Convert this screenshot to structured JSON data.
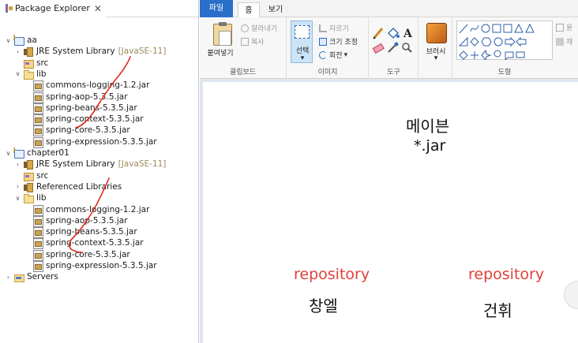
{
  "explorer": {
    "tab_label": "Package Explorer",
    "close_glyph": "✕",
    "tree": [
      {
        "label": "aa",
        "suffix": "",
        "icon": "project",
        "expanded": true
      },
      {
        "label": "JRE System Library",
        "suffix": "[JavaSE-11]",
        "icon": "library",
        "expanded": false
      },
      {
        "label": "src",
        "suffix": "",
        "icon": "src-folder",
        "expanded": null
      },
      {
        "label": "lib",
        "suffix": "",
        "icon": "folder",
        "expanded": true
      },
      {
        "label": "commons-logging-1.2.jar",
        "suffix": "",
        "icon": "jar",
        "expanded": null
      },
      {
        "label": "spring-aop-5.3.5.jar",
        "suffix": "",
        "icon": "jar",
        "expanded": null
      },
      {
        "label": "spring-beans-5.3.5.jar",
        "suffix": "",
        "icon": "jar",
        "expanded": null
      },
      {
        "label": "spring-context-5.3.5.jar",
        "suffix": "",
        "icon": "jar",
        "expanded": null
      },
      {
        "label": "spring-core-5.3.5.jar",
        "suffix": "",
        "icon": "jar",
        "expanded": null
      },
      {
        "label": "spring-expression-5.3.5.jar",
        "suffix": "",
        "icon": "jar",
        "expanded": null
      },
      {
        "label": "chapter01",
        "suffix": "",
        "icon": "project",
        "expanded": true
      },
      {
        "label": "JRE System Library",
        "suffix": "[JavaSE-11]",
        "icon": "library",
        "expanded": false
      },
      {
        "label": "src",
        "suffix": "",
        "icon": "src-folder",
        "expanded": null
      },
      {
        "label": "Referenced Libraries",
        "suffix": "",
        "icon": "library",
        "expanded": false
      },
      {
        "label": "lib",
        "suffix": "",
        "icon": "folder",
        "expanded": true
      },
      {
        "label": "commons-logging-1.2.jar",
        "suffix": "",
        "icon": "jar",
        "expanded": null
      },
      {
        "label": "spring-aop-5.3.5.jar",
        "suffix": "",
        "icon": "jar",
        "expanded": null
      },
      {
        "label": "spring-beans-5.3.5.jar",
        "suffix": "",
        "icon": "jar",
        "expanded": null
      },
      {
        "label": "spring-context-5.3.5.jar",
        "suffix": "",
        "icon": "jar",
        "expanded": null
      },
      {
        "label": "spring-core-5.3.5.jar",
        "suffix": "",
        "icon": "jar",
        "expanded": null
      },
      {
        "label": "spring-expression-5.3.5.jar",
        "suffix": "",
        "icon": "jar",
        "expanded": null
      },
      {
        "label": "Servers",
        "suffix": "",
        "icon": "servers-folder",
        "expanded": false
      }
    ],
    "annotation_color": "#e0281e"
  },
  "paint": {
    "tabs": {
      "file": "파일",
      "home": "홈",
      "view": "보기"
    },
    "clipboard": {
      "paste": "붙여넣기",
      "cut": "잘라내기",
      "copy": "복사",
      "group": "클립보드"
    },
    "image": {
      "select": "선택",
      "crop": "자르기",
      "resize": "크기 조정",
      "rotate": "회전",
      "group": "이미지"
    },
    "tools": {
      "group": "도구"
    },
    "brushes": {
      "label": "브러시"
    },
    "shapes": {
      "group": "도형",
      "outline_partial": "윤",
      "fill_partial": "채"
    },
    "canvas": {
      "line1": "메이븐",
      "line2": "*.jar",
      "left_label": "repository",
      "left_name": "창엘",
      "right_label": "repository",
      "right_name": "건휘",
      "label_color": "#e0403a"
    }
  }
}
